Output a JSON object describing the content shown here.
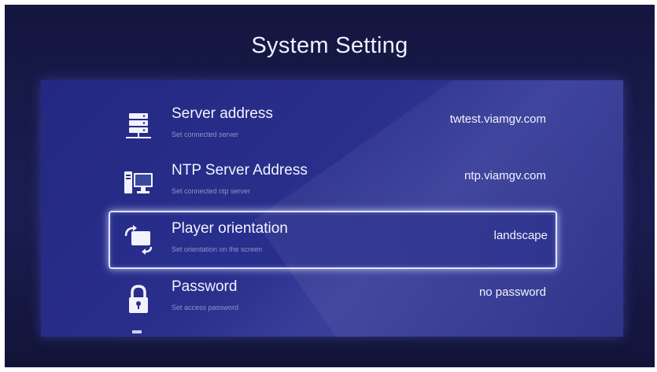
{
  "title": "System Setting",
  "settings": [
    {
      "label": "Server address",
      "description": "Set connected server",
      "value": "twtest.viamgv.com",
      "icon": "server-icon"
    },
    {
      "label": "NTP Server Address",
      "description": "Set connected ntp server",
      "value": "ntp.viamgv.com",
      "icon": "computer-icon"
    },
    {
      "label": "Player orientation",
      "description": "Set orientation on the screen",
      "value": "landscape",
      "icon": "rotate-icon",
      "selected": true
    },
    {
      "label": "Password",
      "description": "Set access password",
      "value": "no password",
      "icon": "lock-icon"
    }
  ],
  "colors": {
    "background": "#1b1d52",
    "panel": "#2a2f8c",
    "highlight": "#dfe3ff"
  }
}
